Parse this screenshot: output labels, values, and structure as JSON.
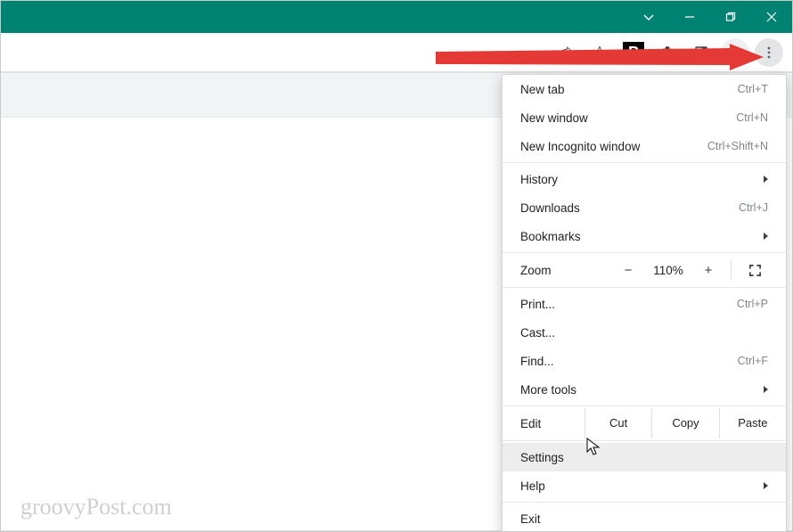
{
  "window_controls": {
    "chevron": "⌄",
    "minimize": "—",
    "maximize": "❐",
    "close": "✕"
  },
  "toolbar": {
    "share_icon": "share-icon",
    "star_icon": "star-icon",
    "extension_label": "P",
    "puzzle_icon": "extensions-icon",
    "readlist_icon": "readinglist-icon",
    "avatar_icon": "avatar-icon",
    "more_icon": "more-icon"
  },
  "menu": {
    "new_tab": {
      "label": "New tab",
      "shortcut": "Ctrl+T"
    },
    "new_window": {
      "label": "New window",
      "shortcut": "Ctrl+N"
    },
    "new_incognito": {
      "label": "New Incognito window",
      "shortcut": "Ctrl+Shift+N"
    },
    "history": {
      "label": "History"
    },
    "downloads": {
      "label": "Downloads",
      "shortcut": "Ctrl+J"
    },
    "bookmarks": {
      "label": "Bookmarks"
    },
    "zoom": {
      "label": "Zoom",
      "value": "110%",
      "minus": "−",
      "plus": "+"
    },
    "print": {
      "label": "Print...",
      "shortcut": "Ctrl+P"
    },
    "cast": {
      "label": "Cast..."
    },
    "find": {
      "label": "Find...",
      "shortcut": "Ctrl+F"
    },
    "more_tools": {
      "label": "More tools"
    },
    "edit": {
      "label": "Edit",
      "cut": "Cut",
      "copy": "Copy",
      "paste": "Paste"
    },
    "settings": {
      "label": "Settings"
    },
    "help": {
      "label": "Help"
    },
    "exit": {
      "label": "Exit"
    }
  },
  "watermark": "groovyPost.com"
}
